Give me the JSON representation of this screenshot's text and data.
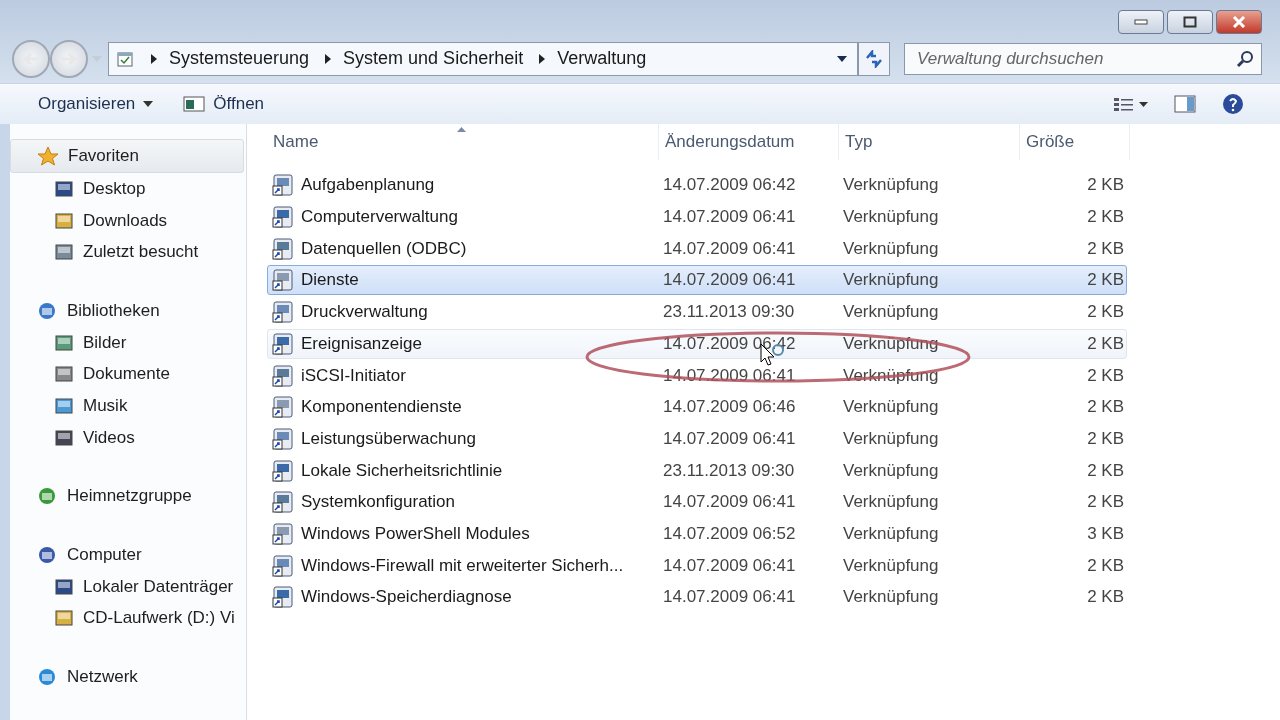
{
  "address_bar": {
    "breadcrumbs": [
      "Systemsteuerung",
      "System und Sicherheit",
      "Verwaltung"
    ]
  },
  "search": {
    "placeholder": "Verwaltung durchsuchen"
  },
  "toolbar": {
    "buttons": [
      {
        "label": "Organisieren",
        "kind": "menu"
      },
      {
        "label": "Öffnen",
        "kind": "open"
      }
    ]
  },
  "sidebar": {
    "groups": [
      {
        "label": "Favoriten",
        "selected": true,
        "children": [
          {
            "label": "Desktop",
            "selected": false
          },
          {
            "label": "Downloads",
            "selected": false
          },
          {
            "label": "Zuletzt besucht",
            "selected": false
          }
        ]
      },
      {
        "label": "Bibliotheken",
        "selected": false,
        "children": [
          {
            "label": "Bilder",
            "selected": false
          },
          {
            "label": "Dokumente",
            "selected": false
          },
          {
            "label": "Musik",
            "selected": false
          },
          {
            "label": "Videos",
            "selected": false
          }
        ]
      },
      {
        "label": "Heimnetzgruppe",
        "selected": false
      },
      {
        "label": "Computer",
        "selected": false,
        "children": [
          {
            "label": "Lokaler Datenträger",
            "selected": false
          },
          {
            "label": "CD-Laufwerk (D:) Vi",
            "selected": false
          }
        ]
      },
      {
        "label": "Netzwerk",
        "selected": false
      }
    ]
  },
  "table": {
    "columns": [
      "Name",
      "Änderungsdatum",
      "Typ",
      "Größe"
    ],
    "rows": [
      {
        "name": "Aufgabenplanung",
        "date": "14.07.2009 06:42",
        "type": "Verknüpfung",
        "size": "2 KB",
        "selected": false,
        "hovered": false
      },
      {
        "name": "Computerverwaltung",
        "date": "14.07.2009 06:41",
        "type": "Verknüpfung",
        "size": "2 KB",
        "selected": false,
        "hovered": false
      },
      {
        "name": "Datenquellen (ODBC)",
        "date": "14.07.2009 06:41",
        "type": "Verknüpfung",
        "size": "2 KB",
        "selected": false,
        "hovered": false
      },
      {
        "name": "Dienste",
        "date": "14.07.2009 06:41",
        "type": "Verknüpfung",
        "size": "2 KB",
        "selected": true,
        "hovered": false
      },
      {
        "name": "Druckverwaltung",
        "date": "23.11.2013 09:30",
        "type": "Verknüpfung",
        "size": "2 KB",
        "selected": false,
        "hovered": false
      },
      {
        "name": "Ereignisanzeige",
        "date": "14.07.2009 06:42",
        "type": "Verknüpfung",
        "size": "2 KB",
        "selected": false,
        "hovered": true
      },
      {
        "name": "iSCSI-Initiator",
        "date": "14.07.2009 06:41",
        "type": "Verknüpfung",
        "size": "2 KB",
        "selected": false,
        "hovered": false
      },
      {
        "name": "Komponentendienste",
        "date": "14.07.2009 06:46",
        "type": "Verknüpfung",
        "size": "2 KB",
        "selected": false,
        "hovered": false
      },
      {
        "name": "Leistungsüberwachung",
        "date": "14.07.2009 06:41",
        "type": "Verknüpfung",
        "size": "2 KB",
        "selected": false,
        "hovered": false
      },
      {
        "name": "Lokale Sicherheitsrichtlinie",
        "date": "23.11.2013 09:30",
        "type": "Verknüpfung",
        "size": "2 KB",
        "selected": false,
        "hovered": false
      },
      {
        "name": "Systemkonfiguration",
        "date": "14.07.2009 06:41",
        "type": "Verknüpfung",
        "size": "2 KB",
        "selected": false,
        "hovered": false
      },
      {
        "name": "Windows PowerShell Modules",
        "date": "14.07.2009 06:52",
        "type": "Verknüpfung",
        "size": "3 KB",
        "selected": false,
        "hovered": false
      },
      {
        "name": "Windows-Firewall mit erweiterter Sicherh...",
        "date": "14.07.2009 06:41",
        "type": "Verknüpfung",
        "size": "2 KB",
        "selected": false,
        "hovered": false
      },
      {
        "name": "Windows-Speicherdiagnose",
        "date": "14.07.2009 06:41",
        "type": "Verknüpfung",
        "size": "2 KB",
        "selected": false,
        "hovered": false
      }
    ]
  },
  "annotation": {
    "kind": "ellipse"
  }
}
